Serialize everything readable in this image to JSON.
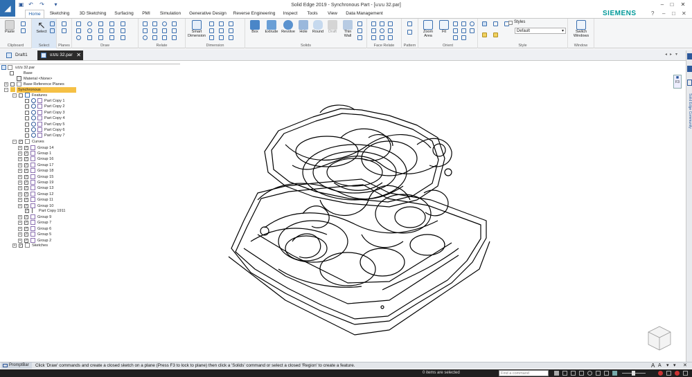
{
  "window": {
    "title": "Solid Edge 2019 - Synchronous Part - [แบบ 32.par]",
    "brand": "SIEMENS"
  },
  "ribbon_tabs": [
    "Home",
    "Sketching",
    "3D Sketching",
    "Surfacing",
    "PMI",
    "Simulation",
    "Generative Design",
    "Reverse Engineering",
    "Inspect",
    "Tools",
    "View",
    "Data Management"
  ],
  "ribbon": {
    "clipboard": {
      "paste": "Paste",
      "group": "Clipboard"
    },
    "select": {
      "select": "Select",
      "group": "Select"
    },
    "planes": {
      "group": "Planes"
    },
    "draw": {
      "group": "Draw"
    },
    "relate": {
      "group": "Relate"
    },
    "dimension": {
      "smart": "Smart Dimension",
      "group": "Dimension"
    },
    "solids": {
      "box": "Box",
      "extrude": "Extrude",
      "revolve": "Revolve",
      "hole": "Hole",
      "round": "Round",
      "draft": "Draft",
      "thinwall": "Thin Wall",
      "group": "Solids"
    },
    "face_relate": {
      "group": "Face Relate"
    },
    "pattern": {
      "group": "Pattern"
    },
    "orient": {
      "zoom_area": "Zoom Area",
      "fit": "Fit",
      "group": "Orient"
    },
    "style": {
      "styles_label": "Styles",
      "styles_value": "Default",
      "group": "Style"
    },
    "window": {
      "switch": "Switch Windows",
      "group": "Window"
    }
  },
  "doc_tabs": [
    {
      "label": "Draft1",
      "active": false
    },
    {
      "label": "แบบ 32.par",
      "active": true
    }
  ],
  "tree": {
    "root": "แบบ 32.par",
    "base": "Base",
    "material": "Material <None>",
    "base_ref": "Base Reference Planes",
    "synchronous": "Synchronous",
    "features": "Features",
    "part_copies": [
      "Part Copy 1",
      "Part Copy 2",
      "Part Copy 3",
      "Part Copy 4",
      "Part Copy 5",
      "Part Copy 6",
      "Part Copy 7"
    ],
    "curves": "Curves",
    "groups": [
      "Group 14",
      "Group 1",
      "Group 16",
      "Group 17",
      "Group 18",
      "Group 15",
      "Group 19",
      "Group 13",
      "Group 12",
      "Group 11",
      "Group 10"
    ],
    "part_copy_1911": "Part Copy 1911",
    "groups_b": [
      "Group 9",
      "Group 7",
      "Group 6",
      "Group 5",
      "Group 2"
    ],
    "sketches": "Sketches"
  },
  "right_panel": {
    "community": "Solid Edge Community",
    "lock_key": "F3"
  },
  "prompt": {
    "label": "PromptBar",
    "text": "Click 'Draw' commands and create a closed sketch on a plane (Press F3 to lock to plane) then click a 'Solids' command or select a closed 'Region' to create a feature."
  },
  "status": {
    "selection": "0 items are selected",
    "find_placeholder": "Find a command"
  },
  "colors": {
    "accent": "#2b579a",
    "brand": "#009999",
    "highlight": "#f5c045"
  }
}
